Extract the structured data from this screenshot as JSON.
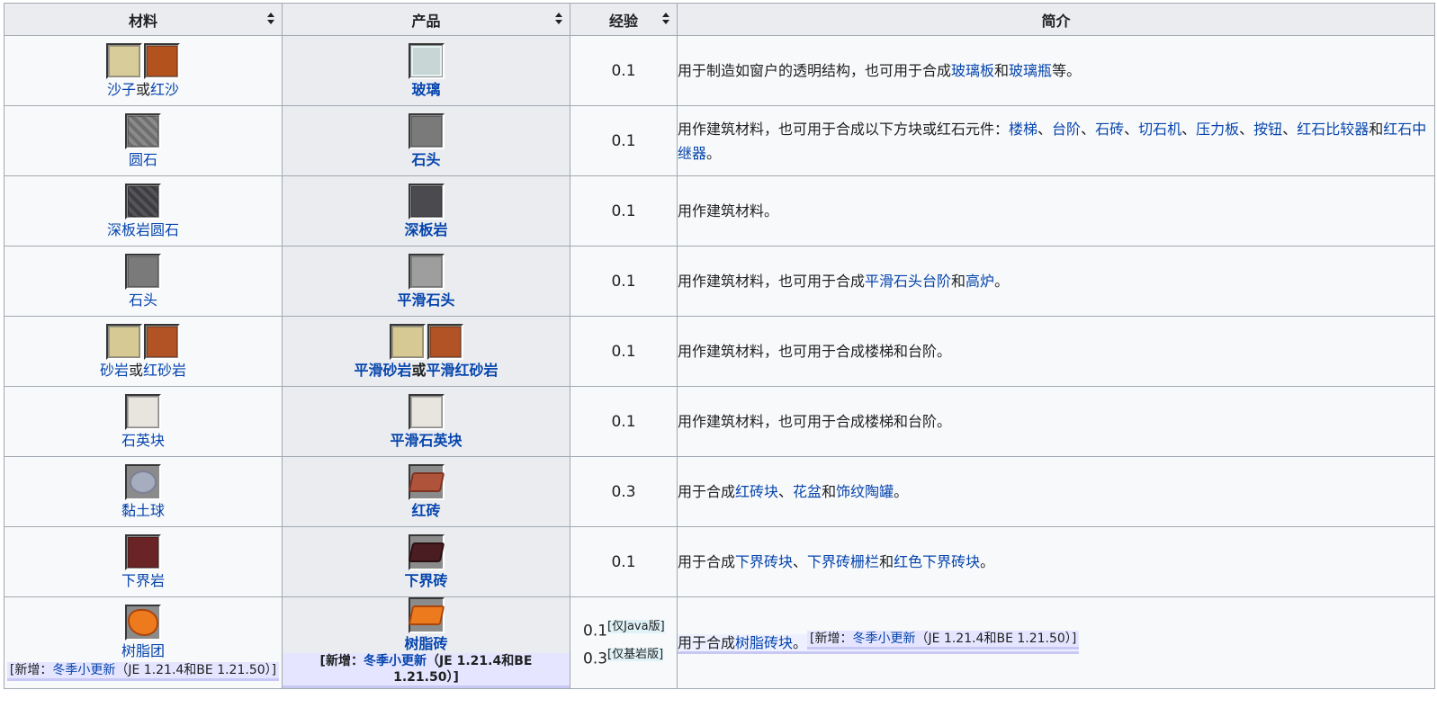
{
  "headers": {
    "material": "材料",
    "product": "产品",
    "xp": "经验",
    "desc": "简介"
  },
  "rows": [
    {
      "materials": [
        {
          "name": "沙子"
        },
        {
          "name": "红沙"
        }
      ],
      "mat_sep": "或",
      "product": {
        "name": "玻璃"
      },
      "xp": "0.1",
      "desc": [
        {
          "t": "用于制造如窗户的透明结构，也可用于合成"
        },
        {
          "l": "玻璃板"
        },
        {
          "t": "和"
        },
        {
          "l": "玻璃瓶"
        },
        {
          "t": "等。"
        }
      ]
    },
    {
      "materials": [
        {
          "name": "圆石"
        }
      ],
      "product": {
        "name": "石头"
      },
      "xp": "0.1",
      "desc": [
        {
          "t": "用作建筑材料，也可用于合成以下方块或红石元件："
        },
        {
          "l": "楼梯"
        },
        {
          "t": "、"
        },
        {
          "l": "台阶"
        },
        {
          "t": "、"
        },
        {
          "l": "石砖"
        },
        {
          "t": "、"
        },
        {
          "l": "切石机"
        },
        {
          "t": "、"
        },
        {
          "l": "压力板"
        },
        {
          "t": "、"
        },
        {
          "l": "按钮"
        },
        {
          "t": "、"
        },
        {
          "l": "红石比较器"
        },
        {
          "t": "和"
        },
        {
          "l": "红石中继器"
        },
        {
          "t": "。"
        }
      ]
    },
    {
      "materials": [
        {
          "name": "深板岩圆石"
        }
      ],
      "product": {
        "name": "深板岩"
      },
      "xp": "0.1",
      "desc": [
        {
          "t": "用作建筑材料。"
        }
      ]
    },
    {
      "materials": [
        {
          "name": "石头"
        }
      ],
      "product": {
        "name": "平滑石头"
      },
      "xp": "0.1",
      "desc": [
        {
          "t": "用作建筑材料，也可用于合成"
        },
        {
          "l": "平滑石头台阶"
        },
        {
          "t": "和"
        },
        {
          "l": "高炉"
        },
        {
          "t": "。"
        }
      ]
    },
    {
      "materials": [
        {
          "name": "砂岩"
        },
        {
          "name": "红砂岩"
        }
      ],
      "mat_sep": "或",
      "products": [
        {
          "name": "平滑砂岩"
        },
        {
          "name": "平滑红砂岩"
        }
      ],
      "prod_sep": "或",
      "xp": "0.1",
      "desc": [
        {
          "t": "用作建筑材料，也可用于合成楼梯和台阶。"
        }
      ]
    },
    {
      "materials": [
        {
          "name": "石英块"
        }
      ],
      "product": {
        "name": "平滑石英块"
      },
      "xp": "0.1",
      "desc": [
        {
          "t": "用作建筑材料，也可用于合成楼梯和台阶。"
        }
      ]
    },
    {
      "materials": [
        {
          "name": "黏土球"
        }
      ],
      "product": {
        "name": "红砖"
      },
      "xp": "0.3",
      "desc": [
        {
          "t": "用于合成"
        },
        {
          "l": "红砖块"
        },
        {
          "t": "、"
        },
        {
          "l": "花盆"
        },
        {
          "t": "和"
        },
        {
          "l": "饰纹陶罐"
        },
        {
          "t": "。"
        }
      ]
    },
    {
      "materials": [
        {
          "name": "下界岩"
        }
      ],
      "product": {
        "name": "下界砖"
      },
      "xp": "0.1",
      "desc": [
        {
          "t": "用于合成"
        },
        {
          "l": "下界砖块"
        },
        {
          "t": "、"
        },
        {
          "l": "下界砖栅栏"
        },
        {
          "t": "和"
        },
        {
          "l": "红色下界砖块"
        },
        {
          "t": "。"
        }
      ]
    },
    {
      "materials": [
        {
          "name": "树脂团"
        }
      ],
      "product": {
        "name": "树脂砖"
      },
      "xp_lines": [
        {
          "value": "0.1",
          "note": "[仅Java版]"
        },
        {
          "value": "0.3",
          "note": "[仅基岩版]"
        }
      ],
      "desc_prefix": "用于合成",
      "desc_link": "树脂砖块",
      "desc_suffix": "。",
      "tag": {
        "open": "[新增：",
        "link": "冬季小更新",
        "middle": "（JE 1.21.4和BE 1.21.50）",
        "close": "]"
      }
    }
  ]
}
